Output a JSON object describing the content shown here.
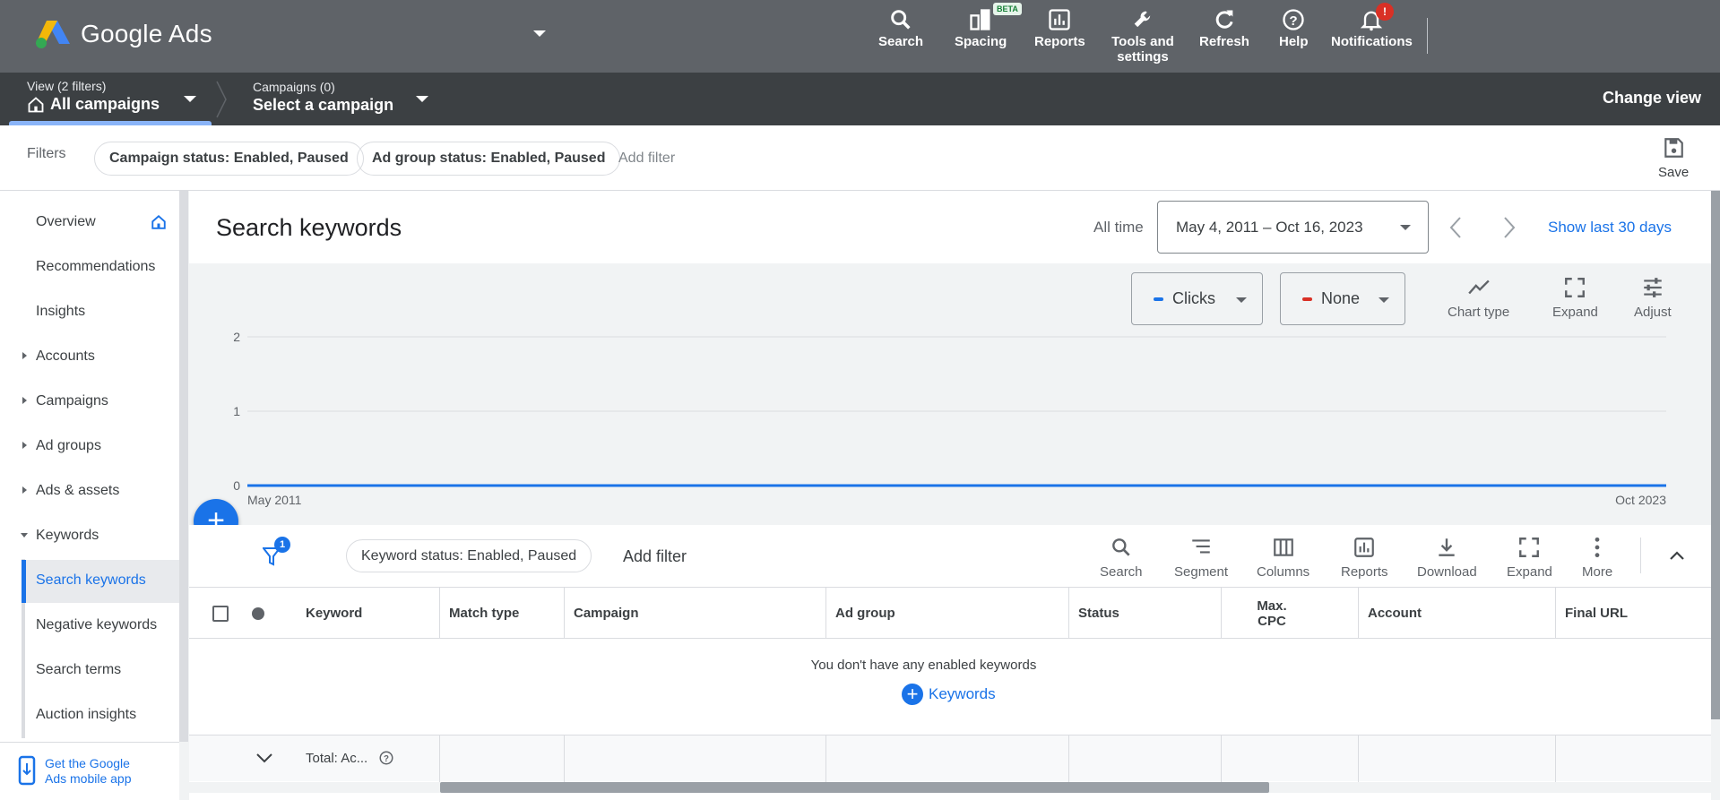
{
  "app": {
    "logo_text": "Google Ads"
  },
  "topnav": [
    {
      "label": "Search"
    },
    {
      "label": "Spacing",
      "badge": "BETA"
    },
    {
      "label": "Reports"
    },
    {
      "label": "Tools and settings"
    },
    {
      "label": "Refresh"
    },
    {
      "label": "Help"
    },
    {
      "label": "Notifications",
      "badge": "!"
    }
  ],
  "viewbar": {
    "view_small": "View (2 filters)",
    "view_big": "All campaigns",
    "campaigns_small": "Campaigns (0)",
    "campaigns_big": "Select a campaign",
    "change_view": "Change view"
  },
  "filters": {
    "label": "Filters",
    "chips": [
      "Campaign status: Enabled, Paused",
      "Ad group status: Enabled, Paused"
    ],
    "add_filter": "Add filter",
    "save": "Save"
  },
  "sidebar": {
    "items": [
      "Overview",
      "Recommendations",
      "Insights",
      "Accounts",
      "Campaigns",
      "Ad groups",
      "Ads & assets",
      "Keywords"
    ],
    "sub_items": [
      "Search keywords",
      "Negative keywords",
      "Search terms",
      "Auction insights"
    ],
    "mobile_app_line1": "Get the Google",
    "mobile_app_line2": "Ads mobile app"
  },
  "main": {
    "title": "Search keywords",
    "range_label": "All time",
    "date_range": "May 4, 2011 – Oct 16, 2023",
    "show_last": "Show last 30 days"
  },
  "chart_controls": {
    "metric1": "Clicks",
    "metric2": "None",
    "metric1_color": "#1a73e8",
    "metric2_color": "#d93025",
    "tools": [
      "Chart type",
      "Expand",
      "Adjust"
    ]
  },
  "chart_data": {
    "type": "line",
    "x": [
      "May 2011",
      "Oct 2023"
    ],
    "series": [
      {
        "values": [
          0,
          0
        ]
      }
    ],
    "yticks": [
      0,
      1,
      2
    ],
    "ylim": [
      0,
      2
    ],
    "grid": true
  },
  "table_toolbar": {
    "filter_count": "1",
    "chip": "Keyword status: Enabled, Paused",
    "add_filter": "Add filter",
    "tools": [
      "Search",
      "Segment",
      "Columns",
      "Reports",
      "Download",
      "Expand",
      "More"
    ]
  },
  "table": {
    "columns": [
      "Keyword",
      "Match type",
      "Campaign",
      "Ad group",
      "Status",
      "Max. CPC",
      "Account",
      "Final URL"
    ],
    "empty_message": "You don't have any enabled keywords",
    "empty_action": "Keywords",
    "total_label": "Total: Ac..."
  }
}
